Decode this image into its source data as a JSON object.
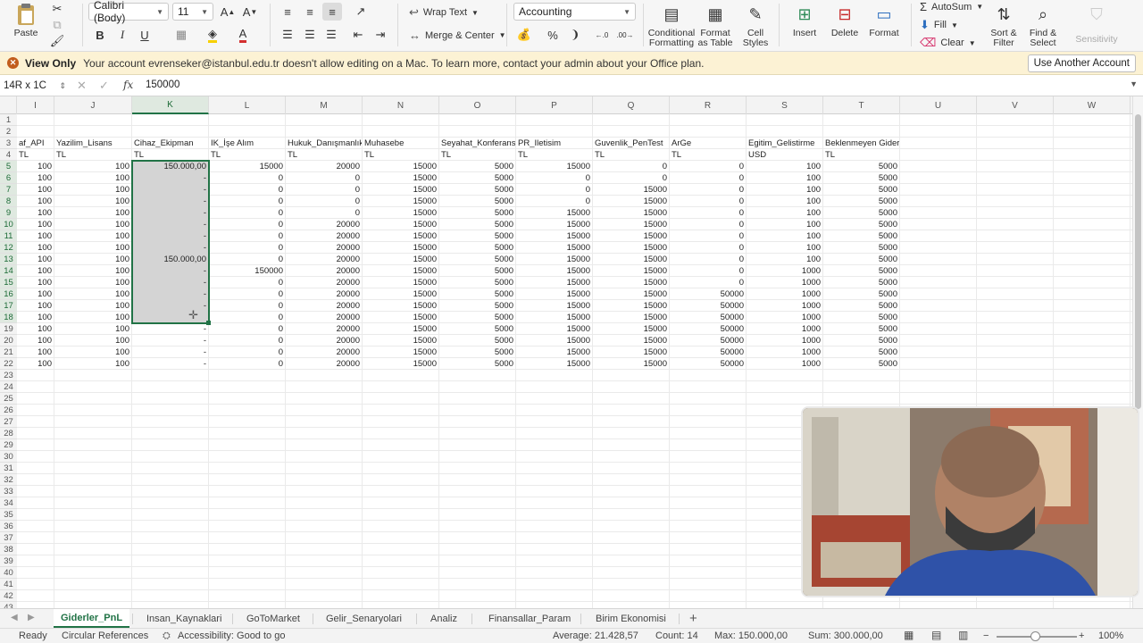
{
  "ribbon": {
    "paste": "Paste",
    "font_name": "Calibri (Body)",
    "font_size": "11",
    "bold": "B",
    "italic": "I",
    "underline": "U",
    "wrap_text": "Wrap Text",
    "merge_center": "Merge & Center",
    "number_format": "Accounting",
    "percent": "%",
    "conditional_formatting": [
      "Conditional",
      "Formatting"
    ],
    "format_as_table": [
      "Format",
      "as Table"
    ],
    "cell_styles": [
      "Cell",
      "Styles"
    ],
    "insert": "Insert",
    "delete": "Delete",
    "format": "Format",
    "autosum": "AutoSum",
    "fill": "Fill",
    "clear": "Clear",
    "sort_filter": [
      "Sort &",
      "Filter"
    ],
    "find_select": [
      "Find &",
      "Select"
    ],
    "sensitivity": "Sensitivity"
  },
  "infobar": {
    "title": "View Only",
    "message": "Your account evrenseker@istanbul.edu.tr doesn't allow editing on a Mac. To learn more, contact your admin about your Office plan.",
    "button": "Use Another Account"
  },
  "formula_bar": {
    "name_box": "14R x 1C",
    "fx": "fx",
    "value": "150000"
  },
  "columns": [
    {
      "letter": "I",
      "label": "af_API"
    },
    {
      "letter": "J",
      "label": "Yazilim_Lisans"
    },
    {
      "letter": "K",
      "label": "Cihaz_Ekipman"
    },
    {
      "letter": "L",
      "label": "IK_İşe Alım"
    },
    {
      "letter": "M",
      "label": "Hukuk_Danışmanlık"
    },
    {
      "letter": "N",
      "label": "Muhasebe"
    },
    {
      "letter": "O",
      "label": "Seyahat_Konferans"
    },
    {
      "letter": "P",
      "label": "PR_Iletisim"
    },
    {
      "letter": "Q",
      "label": "Guvenlik_PenTest"
    },
    {
      "letter": "R",
      "label": "ArGe"
    },
    {
      "letter": "S",
      "label": "Egitim_Gelistirme"
    },
    {
      "letter": "T",
      "label": "Beklenmeyen Gider"
    },
    {
      "letter": "U",
      "label": ""
    },
    {
      "letter": "V",
      "label": ""
    },
    {
      "letter": "W",
      "label": ""
    }
  ],
  "units": [
    "TL",
    "TL",
    "TL",
    "TL",
    "TL",
    "TL",
    "TL",
    "TL",
    "TL",
    "TL",
    "USD",
    "TL",
    "",
    "",
    ""
  ],
  "data_rows": [
    [
      "100",
      "100",
      "150.000,00",
      "15000",
      "20000",
      "15000",
      "5000",
      "15000",
      "0",
      "0",
      "100",
      "5000"
    ],
    [
      "100",
      "100",
      "-",
      "0",
      "0",
      "15000",
      "5000",
      "0",
      "0",
      "0",
      "100",
      "5000"
    ],
    [
      "100",
      "100",
      "-",
      "0",
      "0",
      "15000",
      "5000",
      "0",
      "15000",
      "0",
      "100",
      "5000"
    ],
    [
      "100",
      "100",
      "-",
      "0",
      "0",
      "15000",
      "5000",
      "0",
      "15000",
      "0",
      "100",
      "5000"
    ],
    [
      "100",
      "100",
      "-",
      "0",
      "0",
      "15000",
      "5000",
      "15000",
      "15000",
      "0",
      "100",
      "5000"
    ],
    [
      "100",
      "100",
      "-",
      "0",
      "20000",
      "15000",
      "5000",
      "15000",
      "15000",
      "0",
      "100",
      "5000"
    ],
    [
      "100",
      "100",
      "-",
      "0",
      "20000",
      "15000",
      "5000",
      "15000",
      "15000",
      "0",
      "100",
      "5000"
    ],
    [
      "100",
      "100",
      "-",
      "0",
      "20000",
      "15000",
      "5000",
      "15000",
      "15000",
      "0",
      "100",
      "5000"
    ],
    [
      "100",
      "100",
      "150.000,00",
      "0",
      "20000",
      "15000",
      "5000",
      "15000",
      "15000",
      "0",
      "100",
      "5000"
    ],
    [
      "100",
      "100",
      "-",
      "150000",
      "20000",
      "15000",
      "5000",
      "15000",
      "15000",
      "0",
      "1000",
      "5000"
    ],
    [
      "100",
      "100",
      "-",
      "0",
      "20000",
      "15000",
      "5000",
      "15000",
      "15000",
      "0",
      "1000",
      "5000"
    ],
    [
      "100",
      "100",
      "-",
      "0",
      "20000",
      "15000",
      "5000",
      "15000",
      "15000",
      "50000",
      "1000",
      "5000"
    ],
    [
      "100",
      "100",
      "-",
      "0",
      "20000",
      "15000",
      "5000",
      "15000",
      "15000",
      "50000",
      "1000",
      "5000"
    ],
    [
      "100",
      "100",
      "",
      "0",
      "20000",
      "15000",
      "5000",
      "15000",
      "15000",
      "50000",
      "1000",
      "5000"
    ],
    [
      "100",
      "100",
      "-",
      "0",
      "20000",
      "15000",
      "5000",
      "15000",
      "15000",
      "50000",
      "1000",
      "5000"
    ],
    [
      "100",
      "100",
      "-",
      "0",
      "20000",
      "15000",
      "5000",
      "15000",
      "15000",
      "50000",
      "1000",
      "5000"
    ],
    [
      "100",
      "100",
      "-",
      "0",
      "20000",
      "15000",
      "5000",
      "15000",
      "15000",
      "50000",
      "1000",
      "5000"
    ],
    [
      "100",
      "100",
      "-",
      "0",
      "20000",
      "15000",
      "5000",
      "15000",
      "15000",
      "50000",
      "1000",
      "5000"
    ]
  ],
  "row_numbers": [
    "1",
    "2",
    "3",
    "4",
    "5",
    "6",
    "7",
    "8",
    "9",
    "10",
    "11",
    "12",
    "13",
    "14",
    "15",
    "16",
    "17",
    "18",
    "19",
    "20",
    "21",
    "22",
    "23",
    "24",
    "25",
    "26",
    "27",
    "28",
    "29",
    "30",
    "31",
    "32",
    "33",
    "34",
    "35",
    "36",
    "37",
    "38",
    "39",
    "40",
    "41",
    "42",
    "43"
  ],
  "sheet_tabs": [
    "Giderler_PnL",
    "Insan_Kaynaklari",
    "GoToMarket",
    "Gelir_Senaryolari",
    "Analiz",
    "Finansallar_Param",
    "Birim Ekonomisi"
  ],
  "add_sheet": "+",
  "status": {
    "ready": "Ready",
    "circular": "Circular References",
    "accessibility": "Accessibility: Good to go",
    "average": "Average: 21.428,57",
    "count": "Count: 14",
    "max": "Max: 150.000,00",
    "sum": "Sum: 300.000,00",
    "zoom": "100%"
  },
  "colors": {
    "accent": "#217346",
    "info_bg": "#fcf2d4",
    "selection": "#d4d4d4"
  }
}
